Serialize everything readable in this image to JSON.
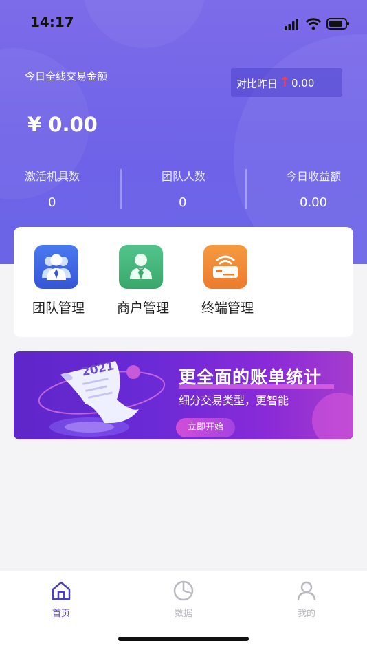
{
  "status_bar": {
    "time": "14:17"
  },
  "header": {
    "today_total_label": "今日全线交易金额",
    "compare_label": "对比昨日",
    "compare_arrow": "↑",
    "compare_value": "0.00",
    "amount": "¥ 0.00",
    "stats": [
      {
        "label": "激活机具数",
        "value": "0"
      },
      {
        "label": "团队人数",
        "value": "0"
      },
      {
        "label": "今日收益额",
        "value": "0.00"
      }
    ]
  },
  "menu": {
    "items": [
      {
        "label": "团队管理",
        "icon": "team-icon",
        "color": "#3e66e0"
      },
      {
        "label": "商户管理",
        "icon": "merchant-icon",
        "color": "#45b57a"
      },
      {
        "label": "终端管理",
        "icon": "terminal-icon",
        "color": "#f08a35"
      }
    ]
  },
  "banner": {
    "year": "2021",
    "title": "更全面的账单统计",
    "subtitle": "细分交易类型，更智能",
    "button_label": "立即开始"
  },
  "tabbar": {
    "items": [
      {
        "label": "首页",
        "icon": "home-icon",
        "active": true
      },
      {
        "label": "数据",
        "icon": "pie-chart-icon",
        "active": false
      },
      {
        "label": "我的",
        "icon": "profile-icon",
        "active": false
      }
    ]
  },
  "colors": {
    "primary": "#6f63e8",
    "active_tab": "#5a4cc9",
    "inactive_tab": "#b9b9c0"
  }
}
